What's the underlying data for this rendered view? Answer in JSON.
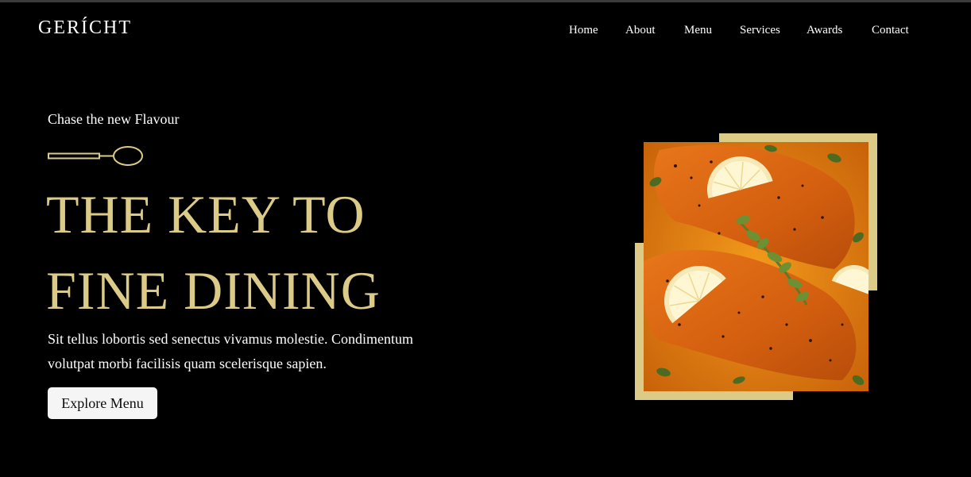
{
  "brand": {
    "logo_text": "GERÍCHT"
  },
  "nav": {
    "items": [
      "Home",
      "About",
      "Menu",
      "Services",
      "Awards",
      "Contact"
    ]
  },
  "hero": {
    "subtitle": "Chase the new Flavour",
    "headline_line1": "THE KEY TO",
    "headline_line2": "FINE DINING",
    "description_line1": "Sit tellus lobortis sed senectus vivamus molestie. Condimentum",
    "description_line2": "volutpat morbi facilisis quam scelerisque sapien.",
    "cta_label": "Explore Menu"
  },
  "icons": {
    "spoon": "spoon-icon"
  },
  "colors": {
    "background": "#000000",
    "accent_gold": "#dcca87",
    "text": "#ffffff",
    "button_bg": "#f5f5f5",
    "button_text": "#0c0c0c"
  }
}
